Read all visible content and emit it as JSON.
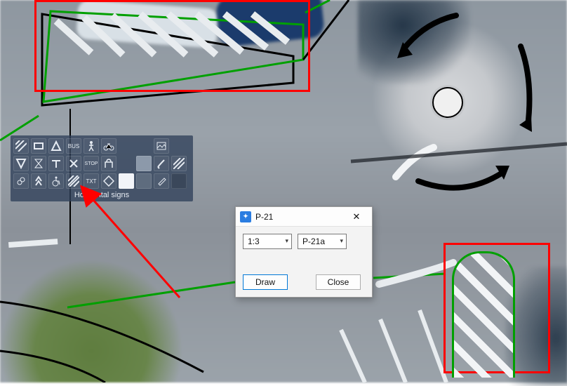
{
  "palette": {
    "title": "Horizontal signs",
    "rows": [
      [
        "diag-icon",
        "rect-icon",
        "tri-icon",
        "bus-text",
        "ped-icon",
        "bike-icon",
        "",
        "",
        "pic-icon",
        ""
      ],
      [
        "yield-icon",
        "hourglass-icon",
        "tbar-icon",
        "cross-icon",
        "stop-text",
        "lock-icon",
        "",
        "sw-grey",
        "brush-icon",
        "hatch-icon"
      ],
      [
        "rings-icon",
        "chevrons-icon",
        "wheelchair-icon",
        "hatch2-icon",
        "txt-text",
        "diamond-icon",
        "sw-white",
        "sw-grey2",
        "paint-icon",
        "sw-dark"
      ]
    ],
    "labels": {
      "bus-text": "BUS",
      "stop-text": "STOP",
      "txt-text": "TXT"
    }
  },
  "dialog": {
    "title": "P-21",
    "ratio": {
      "selected": "1:3"
    },
    "sign_type": {
      "selected": "P-21a"
    },
    "draw_label": "Draw",
    "close_label": "Close"
  },
  "annotations": {
    "highlight_top_left": true,
    "highlight_bottom_right": true,
    "pointer_arrow": true
  }
}
